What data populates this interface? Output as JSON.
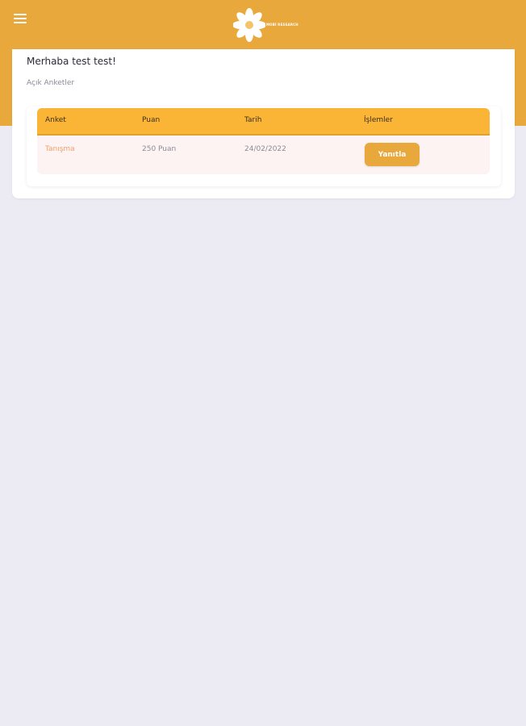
{
  "app": {
    "brand_text": "MOBİ RESEARCH",
    "accent_color": "#e8a83c",
    "header_color": "#fbb536",
    "background_color": "#ecebf4"
  },
  "topbar": {
    "menu_icon": "hamburger-menu-icon",
    "logo_icon": "flower-logo-icon"
  },
  "main": {
    "greeting": "Merhaba test test!",
    "section_title": "Açık Anketler",
    "table": {
      "columns": [
        "Anket",
        "Puan",
        "Tarih",
        "İşlemler"
      ],
      "rows": [
        {
          "name": "Tanışma",
          "points": "250 Puan",
          "date": "24/02/2022",
          "action": "Yanıtla"
        }
      ]
    }
  }
}
